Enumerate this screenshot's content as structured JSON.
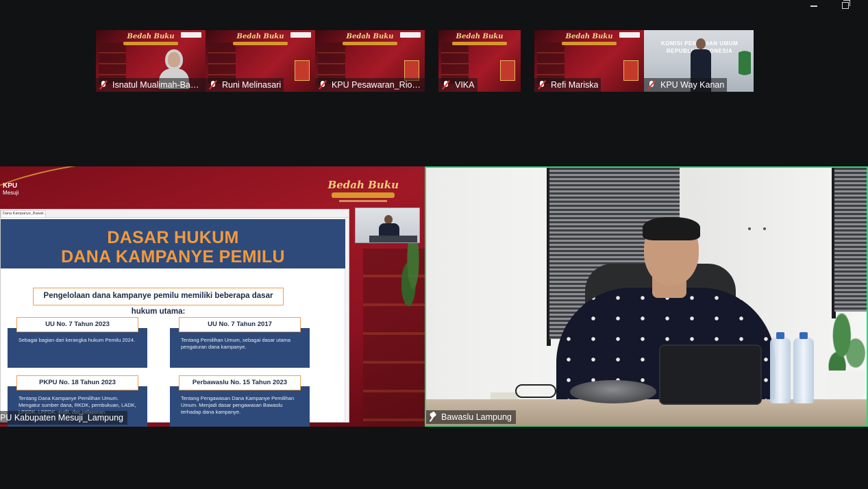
{
  "window_controls": {
    "minimize": "minimize",
    "restore": "restore"
  },
  "participants": [
    {
      "name": "Isnatul Mualimah-Baw...",
      "muted": true,
      "icon": "mic-muted-icon"
    },
    {
      "name": "Runi Melinasari",
      "muted": true,
      "icon": "mic-muted-icon"
    },
    {
      "name": "KPU Pesawaran_Rio S...",
      "muted": true,
      "icon": "mic-muted-icon"
    },
    {
      "name": "VIKA",
      "muted": true,
      "icon": "mic-muted-icon"
    },
    {
      "name": "Refi Mariska",
      "muted": true,
      "icon": "mic-muted-icon"
    },
    {
      "name": "KPU Way Kanan",
      "muted": true,
      "icon": "mic-muted-icon"
    }
  ],
  "thumb_branding": {
    "brand_text": "Bedah Buku",
    "office_sign": "KOMISI PEMILIHAN UMUM REPUBLIK INDONESIA"
  },
  "shared_screen": {
    "owner": "PU Kabupaten Mesuji_Lampung",
    "kpu_logo": "KPU",
    "kpu_logo_sub": "Mesuji",
    "brand_text": "Bedah Buku",
    "doc_tab": "Dana Kampanye_Bawa...",
    "doc_tab_close": "×",
    "slide": {
      "title_line1": "DASAR HUKUM",
      "title_line2": "DANA KAMPANYE PEMILU",
      "intro": "Pengelolaan dana kampanye pemilu memiliki beberapa dasar hukum utama:",
      "cards": [
        {
          "title": "UU No. 7 Tahun 2023",
          "body": "Sebagai bagian dari kerangka hukum Pemilu 2024."
        },
        {
          "title": "UU No. 7 Tahun 2017",
          "body": "Tentang Pemilihan Umum, sebagai dasar utama pengaturan dana kampanye."
        },
        {
          "title": "PKPU No. 18 Tahun 2023",
          "body": "Tentang Dana Kampanye Pemilihan Umum. Mengatur sumber dana, RKDK, pembukuan, LADK, LPSDK, LPPDK, audit, dan pelaporan."
        },
        {
          "title": "Perbawaslu No. 15 Tahun 2023",
          "body": "Tentang Pengawasan Dana Kampanye Pemilihan Umum. Menjadi dasar pengawasan Bawaslu terhadap dana kampanye."
        }
      ]
    }
  },
  "active_speaker": {
    "name": "Bawaslu Lampung",
    "pinned": true,
    "icon": "pin-icon"
  },
  "colors": {
    "active_border": "#2fd47a",
    "muted_mic": "#e0342f",
    "slide_blue": "#2e4a7a",
    "slide_orange": "#f39a3c"
  }
}
